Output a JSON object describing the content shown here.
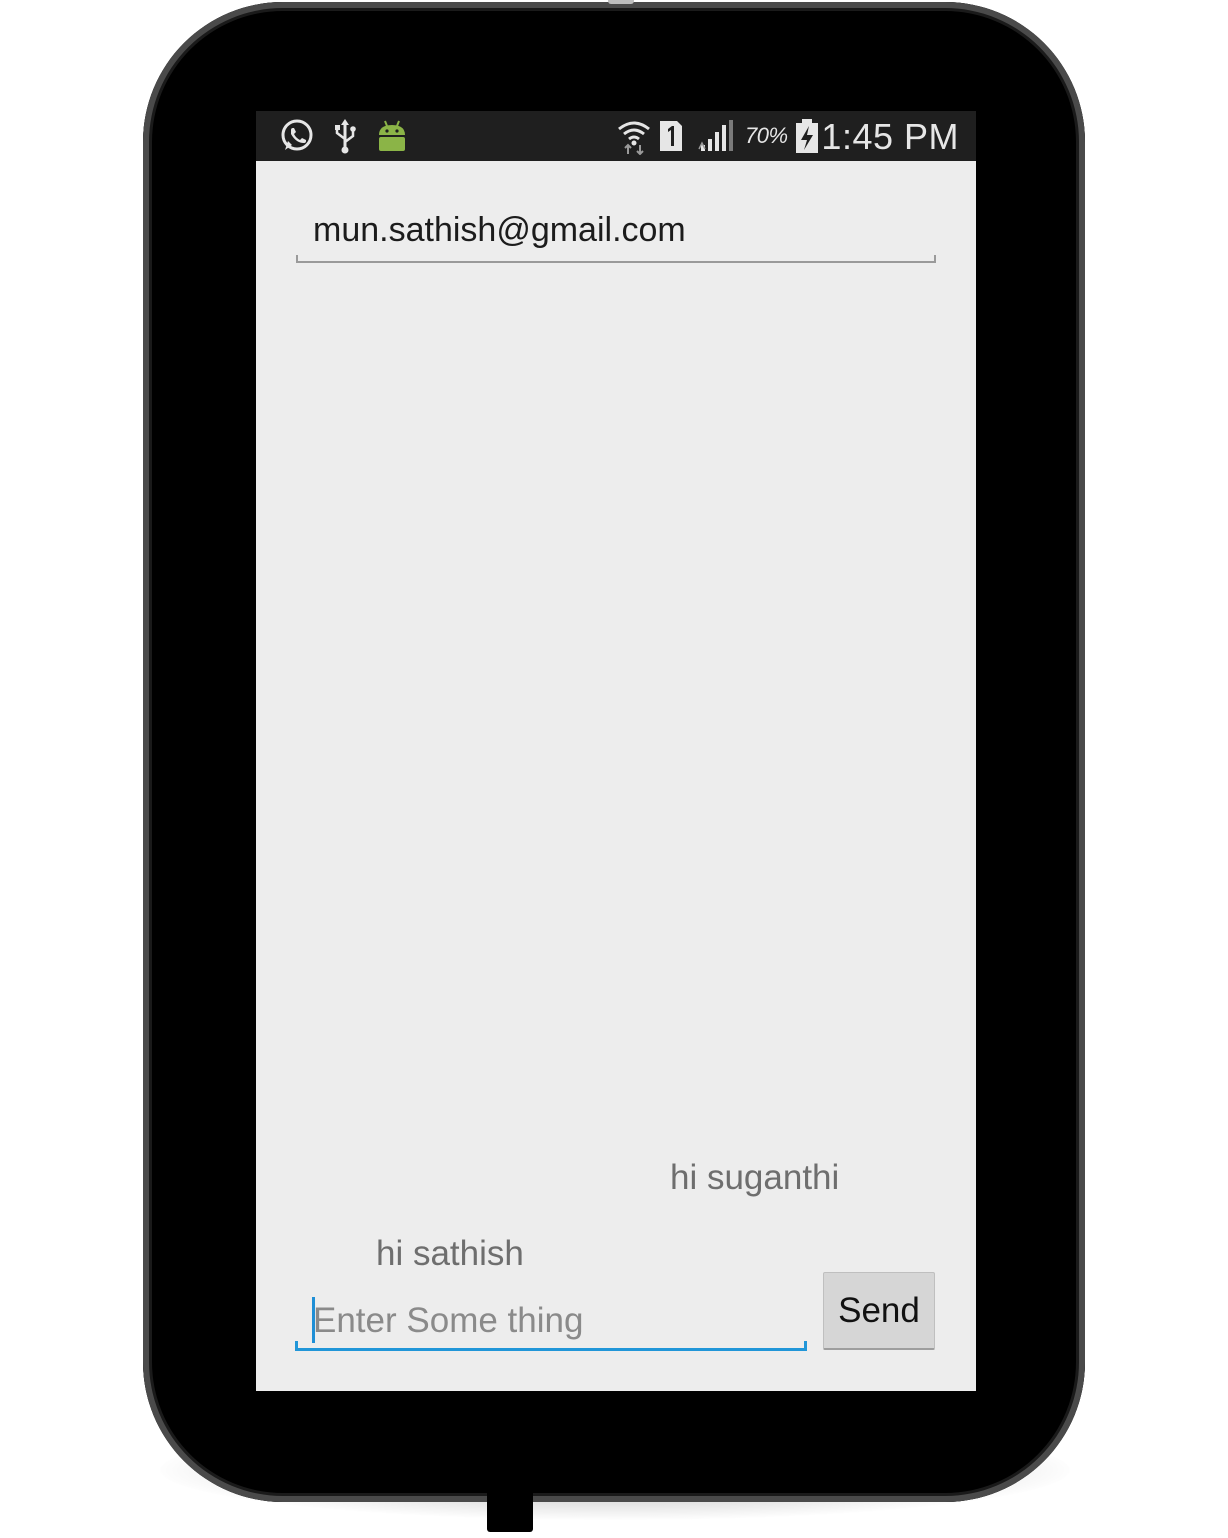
{
  "status_bar": {
    "left_icons": [
      "whatsapp-icon",
      "usb-icon",
      "android-icon"
    ],
    "right_icons": [
      "wifi-icon",
      "sim-1-icon",
      "signal-icon",
      "battery-charging-icon"
    ],
    "battery_percent": "70%",
    "time": "1:45 PM",
    "background": "#1f1f1f",
    "android_color": "#8bb447"
  },
  "recipient": {
    "value": "mun.sathish@gmail.com"
  },
  "messages": [
    {
      "text": "hi suganthi"
    },
    {
      "text": "hi sathish"
    }
  ],
  "composer": {
    "placeholder": "Enter Some thing",
    "send_label": "Send",
    "accent": "#2196d8"
  },
  "screen": {
    "background": "#ededed"
  }
}
